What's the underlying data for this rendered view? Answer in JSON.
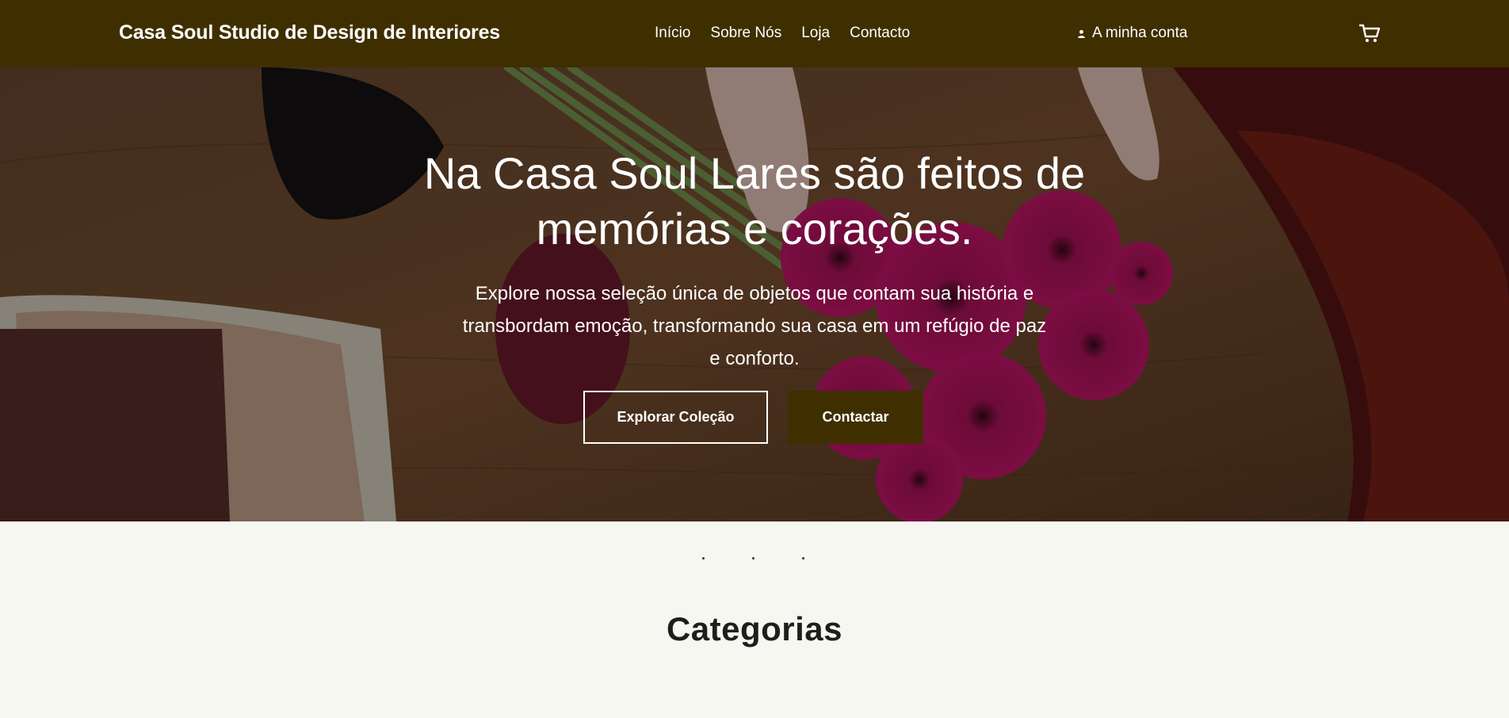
{
  "header": {
    "brand": "Casa Soul Studio de Design de Interiores",
    "nav": [
      "Início",
      "Sobre Nós",
      "Loja",
      "Contacto"
    ],
    "account_label": "A minha conta",
    "cart_icon": "cart-icon",
    "user_icon": "user-icon"
  },
  "hero": {
    "title": "Na Casa Soul Lares são feitos de memórias e corações.",
    "subtitle": "Explore nossa seleção única de objetos que contam sua história e transbordam emoção, transformando sua casa em um refúgio de paz e conforto.",
    "primary_button": "Explorar Coleção",
    "secondary_button": "Contactar"
  },
  "slider": {
    "slides": 3,
    "active": 1
  },
  "section": {
    "title": "Categorias"
  },
  "colors": {
    "brand": "#3f2f00",
    "page_bg": "#f7f7f2",
    "text": "#ffffff"
  }
}
